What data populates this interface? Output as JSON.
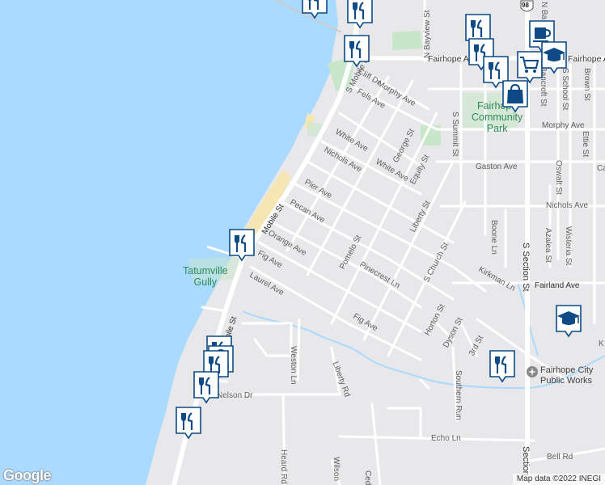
{
  "map": {
    "attribution": "Map data ©2022 INEGI",
    "google_logo": "Google",
    "highway_shield": "98",
    "colors": {
      "water": "#aadaff",
      "land": "#e8e8ea",
      "road": "#ffffff",
      "beach": "#f5e6b3",
      "park": "#c8e6c9",
      "poi_blue": "#0d4a86",
      "park_text": "#2e8b57"
    },
    "parks": {
      "tatumville": "Tatumville\nGully",
      "community": "Fairhope\nCommunity\nPark"
    },
    "place_label": "Fairhope City\nPublic Works",
    "streets": {
      "s_mobile_st": "S Mobile St",
      "mobile_st": "Mobile St",
      "mobile_st_2": "Mobile St",
      "n_bayview_st": "N Bayview St",
      "fairhope_ave": "Fairhope Ave",
      "fairhope_ave_e": "Fairhope Ave",
      "cliff_dr": "Cliff Dr",
      "morphy_ave": "Morphy Ave",
      "fels_ave": "Fels Ave",
      "s_summit_st": "S Summit St",
      "bancroft_st": "Bancroft St",
      "s_school_st": "S School St",
      "brown_st": "Brown St",
      "morphy_ave_e": "Morphy Ave",
      "ettie_st": "Ettie St",
      "white_ave": "White Ave",
      "white_ave_2": "White Ave",
      "george_st": "George St",
      "equity_st": "Equity St",
      "nichols_ave": "Nichols Ave",
      "gaston_ave": "Gaston Ave",
      "oswalt_st": "Oswalt St",
      "pier_ave": "Pier Ave",
      "pecan_ave": "Pecan Ave",
      "liberty_st": "Liberty St",
      "nichols_ave_e": "Nichols Ave",
      "boone_ln": "Boone Ln",
      "azalea_st": "Azalea St",
      "wisteria_st": "Wisteria St",
      "s_section_st": "S Section St",
      "orange_ave": "Orange Ave",
      "pomelo_st": "Pomelo St",
      "fig_ave": "Fig Ave",
      "s_church_st": "S Church St",
      "kirkman_ln": "Kirkman Ln",
      "fairland_ave": "Fairland Ave",
      "laurel_ave": "Laurel Ave",
      "pinecrest_ln": "Pinecrest Ln",
      "horton_st": "Horton St",
      "fig_ave_2": "Fig Ave",
      "dyson_st": "Dyson St",
      "third_st": "3rd St",
      "weston_ln": "Weston Ln",
      "liberty_rd": "Liberty Rd",
      "southern_run": "Southern Run",
      "nelson_dr": "Nelson Dr",
      "echo_ln": "Echo Ln",
      "bell_rd": "Bell Rd",
      "heard_rd": "Heard Rd",
      "wilson": "Wilson",
      "ced": "Ced",
      "section_st_s": "Section",
      "n_ba": "N Ba",
      "ca": "Ca",
      "k": "K"
    },
    "pois": [
      {
        "type": "restaurant",
        "icon": "fork-knife-icon"
      },
      {
        "type": "restaurant",
        "icon": "fork-knife-icon"
      },
      {
        "type": "restaurant",
        "icon": "fork-knife-icon"
      },
      {
        "type": "restaurant",
        "icon": "fork-knife-icon"
      },
      {
        "type": "cafe",
        "icon": "coffee-cup-icon"
      },
      {
        "type": "restaurant",
        "icon": "fork-knife-icon"
      },
      {
        "type": "shopping",
        "icon": "shopping-cart-icon"
      },
      {
        "type": "school",
        "icon": "graduation-cap-icon"
      },
      {
        "type": "restaurant",
        "icon": "fork-knife-icon"
      },
      {
        "type": "shopping",
        "icon": "shopping-bag-icon"
      },
      {
        "type": "restaurant",
        "icon": "fork-knife-icon"
      },
      {
        "type": "school",
        "icon": "graduation-cap-icon"
      },
      {
        "type": "restaurant",
        "icon": "fork-knife-icon"
      },
      {
        "type": "restaurant",
        "icon": "fork-knife-icon"
      },
      {
        "type": "shopping",
        "icon": "shopping-bag-icon"
      },
      {
        "type": "restaurant",
        "icon": "fork-knife-icon"
      },
      {
        "type": "restaurant",
        "icon": "fork-knife-icon"
      },
      {
        "type": "restaurant",
        "icon": "fork-knife-icon"
      },
      {
        "type": "government",
        "icon": "public-works-icon"
      }
    ]
  }
}
